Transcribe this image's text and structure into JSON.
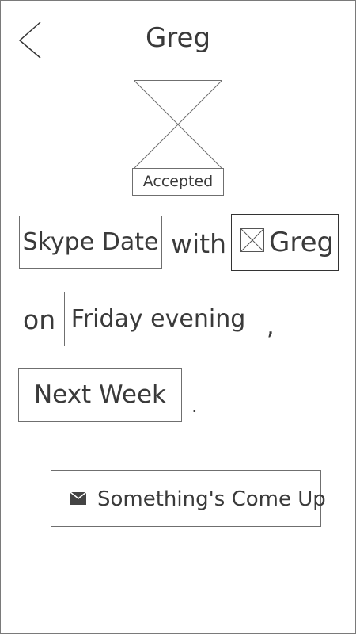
{
  "header": {
    "title": "Greg",
    "back_icon": "chevron-left-icon"
  },
  "profile": {
    "avatar_icon": "image-placeholder-icon",
    "status": "Accepted"
  },
  "sentence": {
    "event_type": "Skype Date",
    "with_word": "with",
    "contact_icon": "image-placeholder-icon",
    "contact_name": "Greg",
    "on_word": "on",
    "time": "Friday evening",
    "comma": ",",
    "date": "Next Week",
    "period": "."
  },
  "action": {
    "icon": "mail-icon",
    "label": "Something's Come Up"
  },
  "colors": {
    "stroke": "#6f6f6f",
    "text": "#3a3a3a",
    "background": "#ffffff"
  }
}
